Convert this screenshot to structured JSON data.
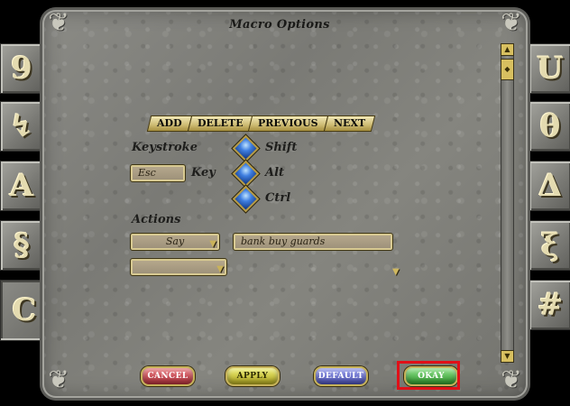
{
  "window": {
    "title": "Macro Options"
  },
  "tabs": [
    {
      "label": "ADD"
    },
    {
      "label": "DELETE"
    },
    {
      "label": "PREVIOUS"
    },
    {
      "label": "NEXT"
    }
  ],
  "keystroke": {
    "label": "Keystroke",
    "key_value": "Esc",
    "key_label": "Key",
    "modifiers": [
      {
        "label": "Shift"
      },
      {
        "label": "Alt"
      },
      {
        "label": "Ctrl"
      }
    ]
  },
  "actions": {
    "label": "Actions",
    "rows": [
      {
        "action": "Say",
        "text": "bank buy guards"
      },
      {
        "action": "",
        "text": ""
      }
    ]
  },
  "buttons": {
    "cancel": "CANCEL",
    "apply": "APPLY",
    "default": "DEFAULT",
    "okay": "OKAY"
  },
  "side_buttons": {
    "left": [
      "9",
      "↯",
      "A",
      "§",
      "C"
    ],
    "right": [
      "U",
      "θ",
      "Δ",
      "ξ",
      "#"
    ]
  },
  "colors": {
    "highlight": "#e01018",
    "gem": "#3e7ee0",
    "cancel": "#b4303a",
    "apply": "#b3a91f",
    "default": "#4a50b6",
    "okay": "#2f9a2c"
  }
}
